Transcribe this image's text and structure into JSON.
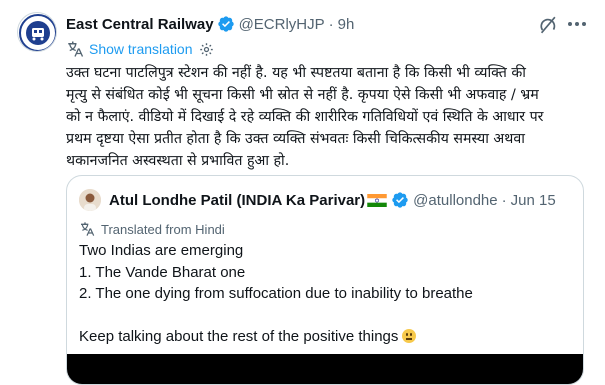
{
  "tweet": {
    "author_name": "East Central Railway",
    "handle": "@ECRlyHJP",
    "separator": "·",
    "time": "9h",
    "show_translation": "Show translation",
    "text_lines": [
      "उक्त घटना पाटलिपुत्र स्टेशन की नहीं है. यह भी स्पष्टतया बताना है कि किसी भी व्यक्ति की",
      "मृत्यु से संबंधित कोई भी सूचना किसी भी स्रोत से नहीं है. कृपया ऐसे किसी भी अफवाह / भ्रम",
      "को न फैलाएं. वीडियो में दिखाई दे रहे व्यक्ति की शारीरिक गतिविधियों एवं स्थिति के आधार पर",
      "प्रथम दृष्टया ऐसा प्रतीत होता है कि उक्त व्यक्ति संभवतः किसी चिकित्सकीय समस्या  अथवा",
      "थकानजनित अस्वस्थता से प्रभावित हुआ हो."
    ]
  },
  "quoted": {
    "author_name": "Atul Londhe Patil (INDIA Ka Parivar)",
    "handle": "@atullondhe",
    "separator": "·",
    "date": "Jun 15",
    "translated_label": "Translated from Hindi",
    "lines": [
      "Two Indias are emerging",
      "1. The Vande Bharat one",
      "2. The one dying from suffocation due to inability to breathe",
      "",
      "Keep talking about the rest of the positive things"
    ]
  },
  "colors": {
    "accent": "#1d9bf0",
    "secondary_text": "#536471",
    "border": "#cfd9de"
  }
}
